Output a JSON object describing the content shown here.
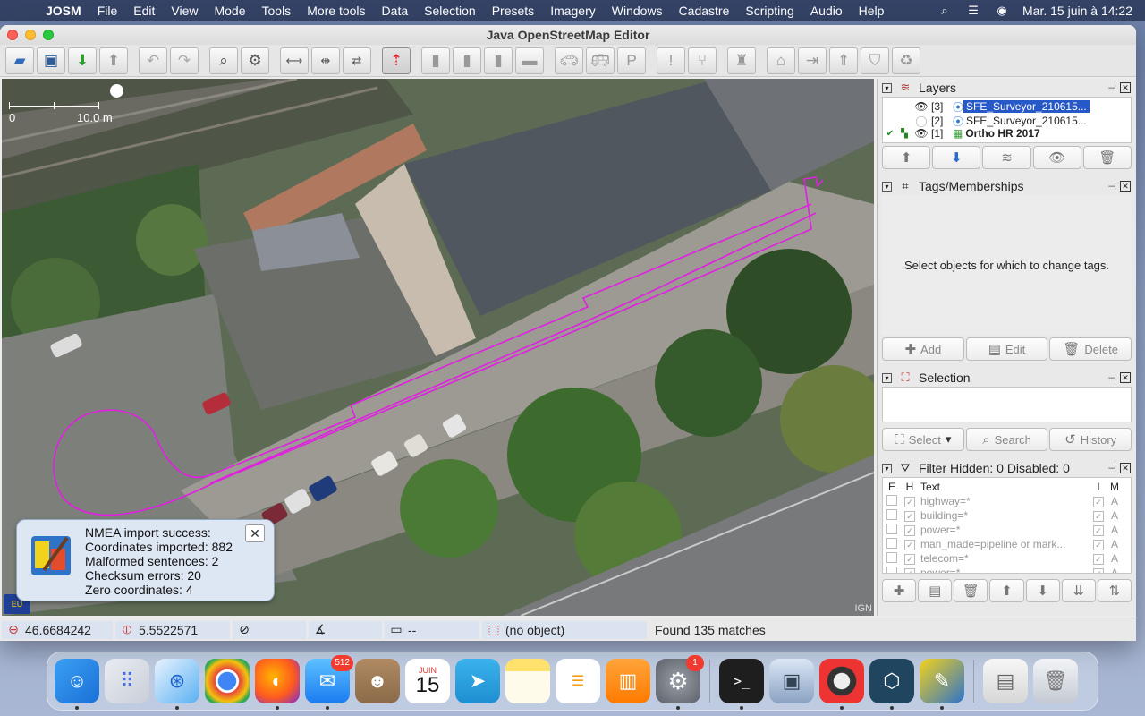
{
  "menubar": {
    "app": "JOSM",
    "items": [
      "File",
      "Edit",
      "View",
      "Mode",
      "Tools",
      "More tools",
      "Data",
      "Selection",
      "Presets",
      "Imagery",
      "Windows",
      "Cadastre",
      "Scripting",
      "Audio",
      "Help"
    ],
    "datetime": "Mar. 15 juin à  14:22"
  },
  "window": {
    "title": "Java OpenStreetMap Editor"
  },
  "map": {
    "scale_zero": "0",
    "scale_distance": "10.0 m",
    "attribution": "IGN",
    "eu_label": "EU",
    "track_color": "#e020e0"
  },
  "notification": {
    "lines": [
      "NMEA import success:",
      "Coordinates imported: 882",
      "Malformed sentences: 2",
      "Checksum errors: 20",
      "Zero coordinates: 4"
    ]
  },
  "layers": {
    "title": "Layers",
    "rows": [
      {
        "index": "[3]",
        "name": "SFE_Surveyor_210615...",
        "selected": true
      },
      {
        "index": "[2]",
        "name": "SFE_Surveyor_210615...",
        "selected": false
      },
      {
        "index": "[1]",
        "name": "Ortho HR 2017",
        "selected": false
      }
    ]
  },
  "tags": {
    "title": "Tags/Memberships",
    "empty_text": "Select objects for which to change tags.",
    "add_label": "Add",
    "edit_label": "Edit",
    "delete_label": "Delete"
  },
  "selection": {
    "title": "Selection",
    "select_label": "Select",
    "search_label": "Search",
    "history_label": "History"
  },
  "filter": {
    "title": "Filter Hidden: 0 Disabled: 0",
    "headers": {
      "e": "E",
      "h": "H",
      "text": "Text",
      "i": "I",
      "m": "M"
    },
    "rows": [
      {
        "text": "highway=*",
        "m": "A"
      },
      {
        "text": "building=*",
        "m": "A"
      },
      {
        "text": "power=*",
        "m": "A"
      },
      {
        "text": "man_made=pipeline or mark...",
        "m": "A"
      },
      {
        "text": "telecom=*",
        "m": "A"
      },
      {
        "text": "power=*",
        "m": "A"
      }
    ]
  },
  "statusbar": {
    "lat": "46.6684242",
    "lon": "5.5522571",
    "length": "--",
    "object": "(no object)",
    "message": "Found 135 matches"
  },
  "dock": {
    "mail_badge": "512",
    "calendar_month": "JUIN",
    "calendar_day": "15",
    "settings_badge": "1"
  }
}
